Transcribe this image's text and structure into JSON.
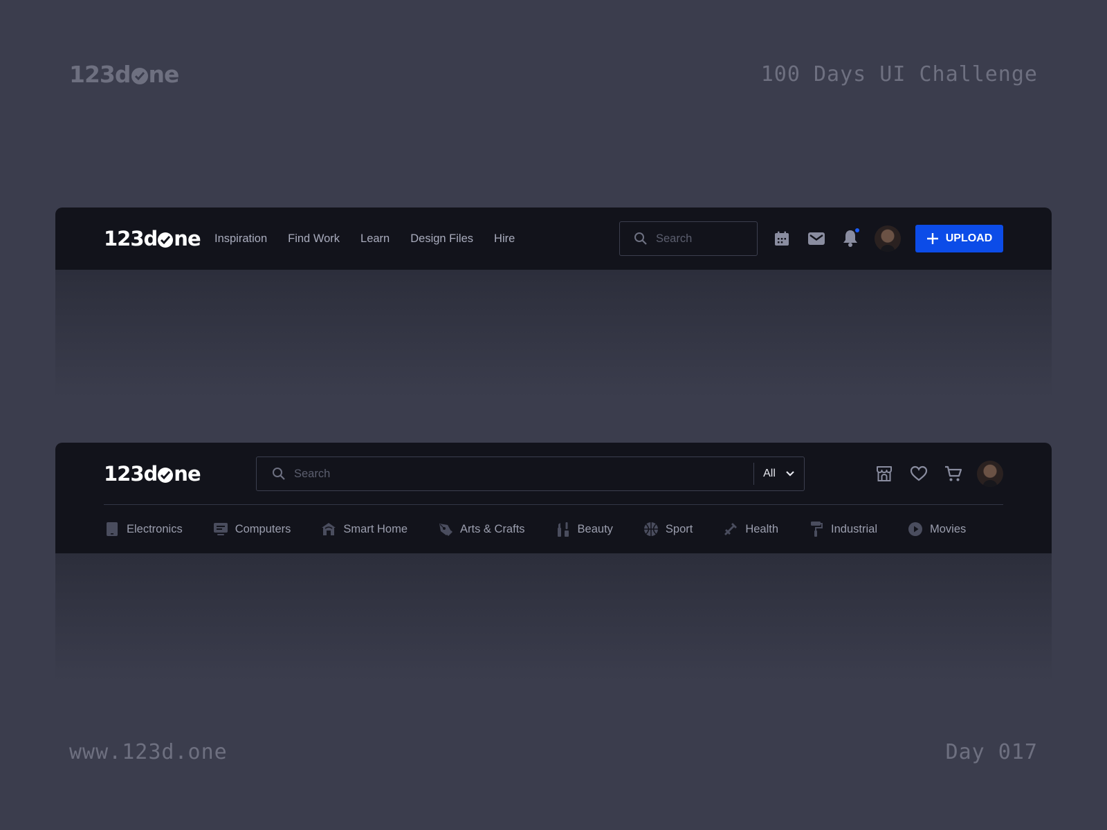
{
  "page": {
    "brand_parts": [
      "123d",
      "ne"
    ],
    "title": "100 Days UI Challenge",
    "url": "www.123d.one",
    "day": "Day 017"
  },
  "navbar1": {
    "logo_parts": [
      "123d",
      "ne"
    ],
    "links": [
      "Inspiration",
      "Find Work",
      "Learn",
      "Design Files",
      "Hire"
    ],
    "search_placeholder": "Search",
    "icons": [
      "calendar-icon",
      "mail-icon",
      "bell-icon"
    ],
    "notification_dot_color": "#1b5cf5",
    "upload_label": "UPLOAD",
    "upload_color": "#0c4ce8"
  },
  "navbar2": {
    "logo_parts": [
      "123d",
      "ne"
    ],
    "search_placeholder": "Search",
    "scope_value": "All",
    "icons": [
      "store-icon",
      "heart-icon",
      "cart-icon"
    ],
    "categories": [
      {
        "label": "Electronics",
        "icon": "phone-icon"
      },
      {
        "label": "Computers",
        "icon": "monitor-icon"
      },
      {
        "label": "Smart Home",
        "icon": "home-icon"
      },
      {
        "label": "Arts & Crafts",
        "icon": "pen-tool-icon"
      },
      {
        "label": "Beauty",
        "icon": "cosmetics-icon"
      },
      {
        "label": "Sport",
        "icon": "basketball-icon"
      },
      {
        "label": "Health",
        "icon": "syringe-icon"
      },
      {
        "label": "Industrial",
        "icon": "paint-roller-icon"
      },
      {
        "label": "Movies",
        "icon": "play-icon"
      }
    ]
  }
}
